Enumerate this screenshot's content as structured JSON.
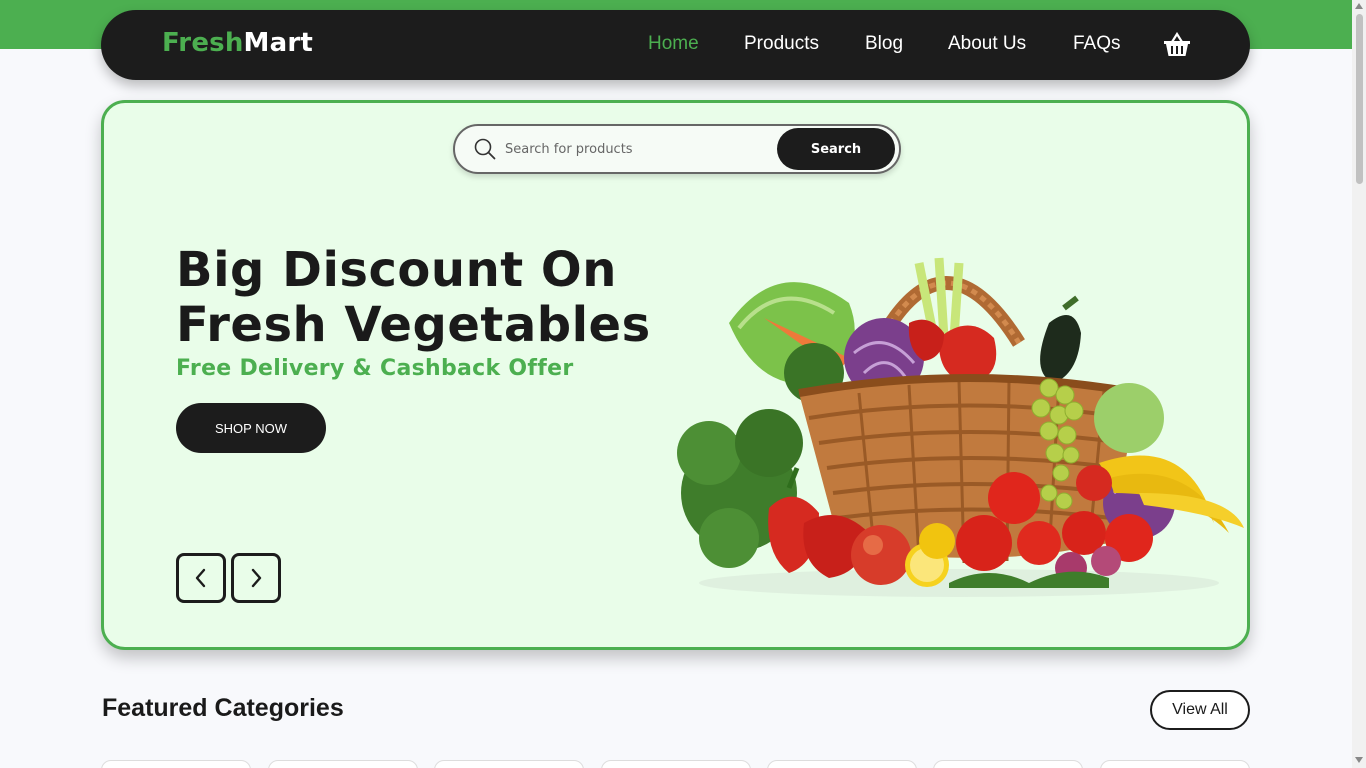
{
  "brand": {
    "part1": "Fresh",
    "part2": "Mart"
  },
  "nav": {
    "items": [
      "Home",
      "Products",
      "Blog",
      "About Us",
      "FAQs"
    ],
    "active": "Home",
    "cart_icon": "basket-icon"
  },
  "search": {
    "placeholder": "Search for products",
    "value": "",
    "button_label": "Search",
    "icon": "search-icon"
  },
  "hero": {
    "title_line1": "Big Discount On",
    "title_line2": "Fresh Vegetables",
    "subtitle": "Free Delivery & Cashback Offer",
    "cta_label": "SHOP NOW",
    "prev_icon": "chevron-left-icon",
    "next_icon": "chevron-right-icon",
    "image": "vegetable-basket-image"
  },
  "featured": {
    "title": "Featured Categories",
    "view_all_label": "View All"
  },
  "colors": {
    "accent": "#4caf50",
    "dark": "#1c1c1c",
    "hero_bg": "#e9fde9",
    "page_bg": "#f8f9fc"
  }
}
